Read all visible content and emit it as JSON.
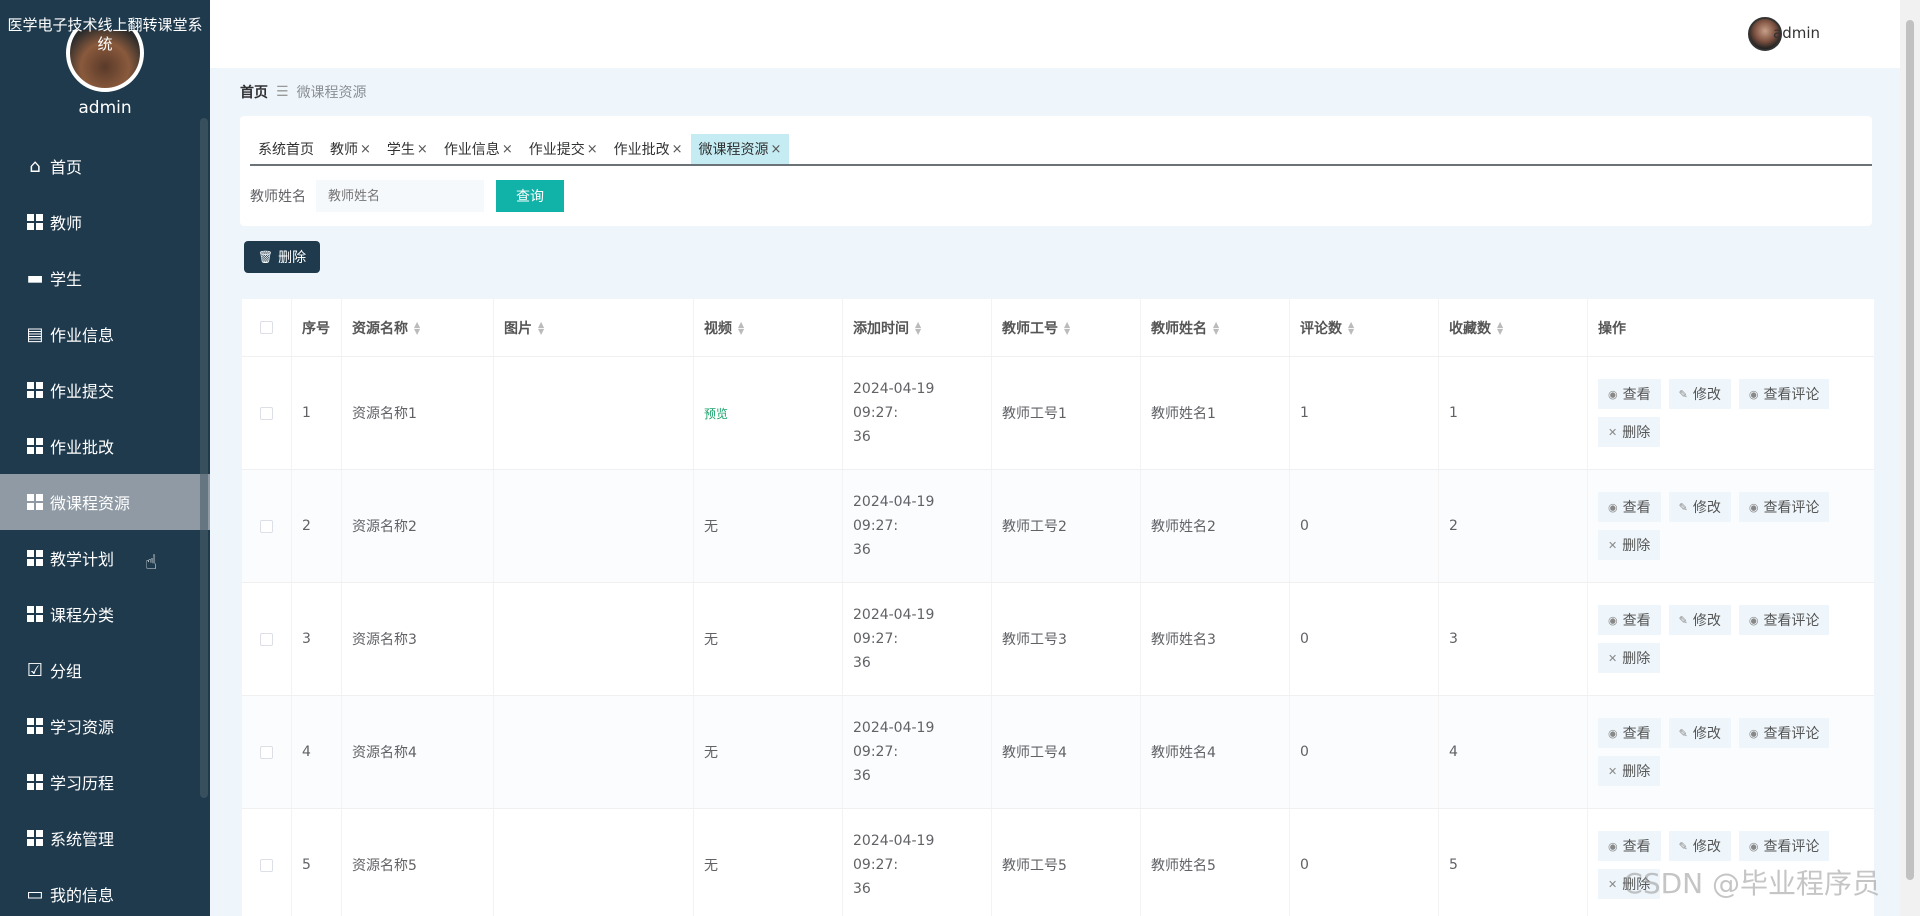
{
  "sidebar": {
    "app_title": "医学电子技术线上翻转课堂系统",
    "username": "admin",
    "items": [
      {
        "label": "首页",
        "icon": "home-icon"
      },
      {
        "label": "教师",
        "icon": "grid-icon"
      },
      {
        "label": "学生",
        "icon": "monitor-icon"
      },
      {
        "label": "作业信息",
        "icon": "clipboard-icon"
      },
      {
        "label": "作业提交",
        "icon": "grid-icon"
      },
      {
        "label": "作业批改",
        "icon": "grid-icon"
      },
      {
        "label": "微课程资源",
        "icon": "grid-icon"
      },
      {
        "label": "教学计划",
        "icon": "grid-icon"
      },
      {
        "label": "课程分类",
        "icon": "grid-icon"
      },
      {
        "label": "分组",
        "icon": "clipboard-check-icon"
      },
      {
        "label": "学习资源",
        "icon": "grid-icon"
      },
      {
        "label": "学习历程",
        "icon": "grid-icon"
      },
      {
        "label": "系统管理",
        "icon": "grid-icon"
      },
      {
        "label": "我的信息",
        "icon": "card-icon"
      }
    ]
  },
  "header": {
    "username": "admin"
  },
  "breadcrumb": {
    "home": "首页",
    "sep": "☰",
    "current": "微课程资源"
  },
  "tabs": [
    {
      "label": "系统首页",
      "closable": false
    },
    {
      "label": "教师",
      "closable": true
    },
    {
      "label": "学生",
      "closable": true
    },
    {
      "label": "作业信息",
      "closable": true
    },
    {
      "label": "作业提交",
      "closable": true
    },
    {
      "label": "作业批改",
      "closable": true
    },
    {
      "label": "微课程资源",
      "closable": true,
      "active": true
    }
  ],
  "search": {
    "label": "教师姓名",
    "placeholder": "教师姓名",
    "button": "查询"
  },
  "toolbar": {
    "delete_label": "删除"
  },
  "table": {
    "headers": [
      "序号",
      "资源名称",
      "图片",
      "视频",
      "添加时间",
      "教师工号",
      "教师姓名",
      "评论数",
      "收藏数",
      "操作"
    ],
    "rows": [
      {
        "no": "1",
        "name": "资源名称1",
        "video": "预览",
        "time1": "2024-04-19 09:27:",
        "time2": "36",
        "tid": "教师工号1",
        "tname": "教师姓名1",
        "comments": "1",
        "favs": "1"
      },
      {
        "no": "2",
        "name": "资源名称2",
        "video": "无",
        "time1": "2024-04-19 09:27:",
        "time2": "36",
        "tid": "教师工号2",
        "tname": "教师姓名2",
        "comments": "0",
        "favs": "2"
      },
      {
        "no": "3",
        "name": "资源名称3",
        "video": "无",
        "time1": "2024-04-19 09:27:",
        "time2": "36",
        "tid": "教师工号3",
        "tname": "教师姓名3",
        "comments": "0",
        "favs": "3"
      },
      {
        "no": "4",
        "name": "资源名称4",
        "video": "无",
        "time1": "2024-04-19 09:27:",
        "time2": "36",
        "tid": "教师工号4",
        "tname": "教师姓名4",
        "comments": "0",
        "favs": "4"
      },
      {
        "no": "5",
        "name": "资源名称5",
        "video": "无",
        "time1": "2024-04-19 09:27:",
        "time2": "36",
        "tid": "教师工号5",
        "tname": "教师姓名5",
        "comments": "0",
        "favs": "5"
      }
    ],
    "actions": {
      "view": "查看",
      "edit": "修改",
      "comments": "查看评论",
      "delete": "删除"
    }
  },
  "watermark": "CSDN @毕业程序员",
  "colors": {
    "sidebar_bg": "#1f3a4d",
    "accent": "#11b3a8",
    "active_tab": "#c5ecf2"
  }
}
